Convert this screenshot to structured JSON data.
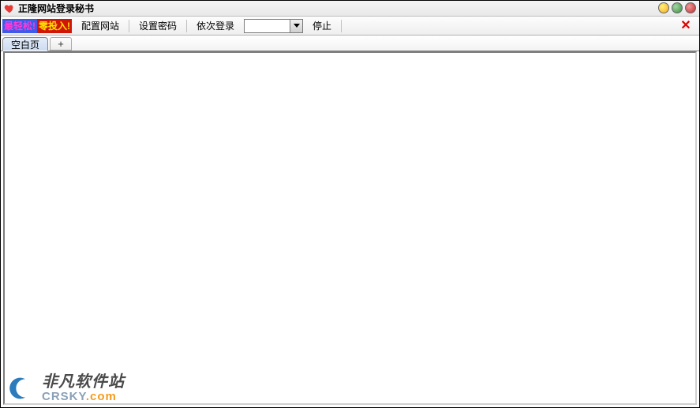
{
  "titlebar": {
    "title": "正隆网站登录秘书"
  },
  "toolbar": {
    "promo_a": "最轻松!",
    "promo_b": "零投入!",
    "config_site": "配置网站",
    "set_password": "设置密码",
    "login_sequence": "依次登录",
    "select_value": "",
    "stop": "停止",
    "close_symbol": "✕"
  },
  "tabs": {
    "blank_page": "空白页",
    "add_symbol": "+"
  },
  "watermark": {
    "site_name": "非凡软件站",
    "domain_prefix": "CRSKY",
    "domain_suffix": ".com"
  }
}
